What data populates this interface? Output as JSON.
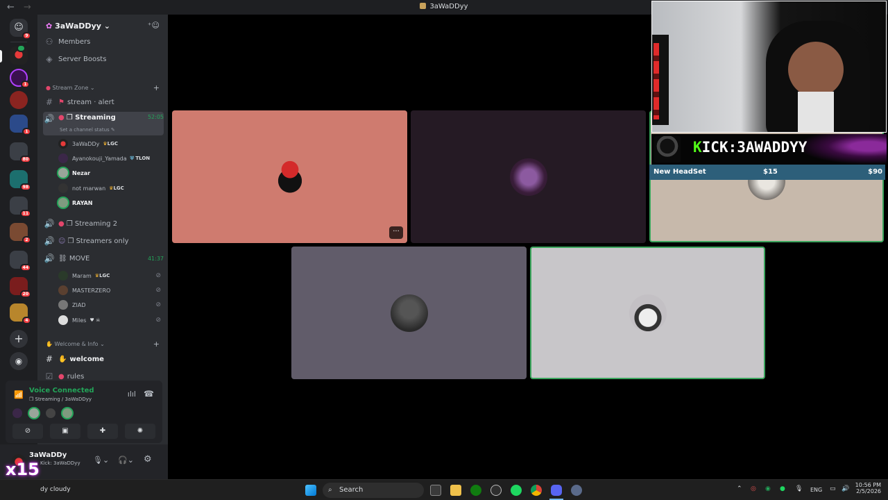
{
  "window": {
    "title": "3aWaDDyy"
  },
  "server": {
    "name": "3aWaDDyy",
    "members_label": "Members",
    "boosts_label": "Server Boosts"
  },
  "rail": {
    "badges": [
      "9",
      "1",
      "1",
      "80",
      "98",
      "11",
      "2",
      "44",
      "20",
      "4"
    ]
  },
  "categories": {
    "stream_zone": "Stream Zone",
    "welcome_info": "Welcome & Info"
  },
  "channels": {
    "stream_alert": "stream · alert",
    "streaming": "❐ Streaming",
    "streaming_time": "52:05",
    "streaming_status": "Set a channel status",
    "streaming2": "❐ Streaming 2",
    "streamers_only": "❐ Streamers only",
    "move": "⛓ MOVE",
    "move_time": "41:37",
    "welcome": "welcome",
    "rules": "rules"
  },
  "streaming_users": [
    {
      "name": "3aWaDDy",
      "tag": "LGC"
    },
    {
      "name": "Ayanokouji_Yamada",
      "tag": "TLON"
    },
    {
      "name": "Nezar",
      "tag": ""
    },
    {
      "name": "not marwan",
      "tag": "LGC"
    },
    {
      "name": "RAYAN",
      "tag": ""
    }
  ],
  "move_users": [
    {
      "name": "Maram",
      "tag": "LGC"
    },
    {
      "name": "MASTERZERO",
      "tag": ""
    },
    {
      "name": "ZIAD",
      "tag": ""
    },
    {
      "name": "Miles",
      "tag": "♥ ☠"
    }
  ],
  "voice": {
    "status": "Voice Connected",
    "location": "❐ Streaming / 3aWaDDyy"
  },
  "user": {
    "name": "3aWaDDy",
    "status": "Kick: 3aWaDDyy",
    "overlay_text": "x15"
  },
  "kick_banner": {
    "prefix": "K",
    "rest": "ICK:3AWADDYY"
  },
  "goal": {
    "label": "New HeadSet",
    "current": "$15",
    "target": "$90"
  },
  "taskbar": {
    "weather": "dy cloudy",
    "search_placeholder": "Search",
    "lang": "ENG",
    "time": "10:56 PM",
    "date": "2/5/2026"
  },
  "colors": {
    "tile_pink": "#cf7b6f",
    "tile_purple": "#251a24",
    "tile_tan": "#c7b9ab",
    "tile_grey": "#615c6a",
    "tile_light": "#c8c6c9",
    "speaking_green": "#3ba55d",
    "kick_green": "#53fc18"
  }
}
